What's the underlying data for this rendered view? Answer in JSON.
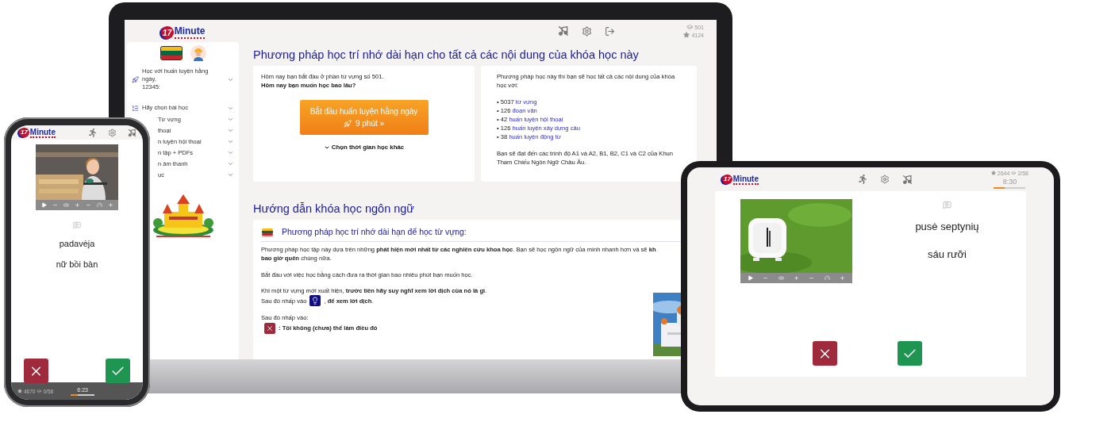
{
  "laptop": {
    "header": {
      "logo": {
        "number": "17",
        "word": "Minute"
      },
      "stats": [
        "501",
        "4124"
      ]
    },
    "sidebar": {
      "daily": {
        "lines": [
          "Học với huấn luyện hằng",
          "ngày,",
          "12345:"
        ]
      },
      "items": [
        {
          "kind": "picker",
          "label": "Hãy chọn bài học"
        },
        {
          "kind": "section",
          "label": "Từ vựng"
        },
        {
          "kind": "section",
          "label": "thoại"
        },
        {
          "kind": "section",
          "label": "n luyện hội thoại"
        },
        {
          "kind": "section",
          "label": "n tập + PDFs"
        },
        {
          "kind": "section",
          "label": "n âm thanh"
        },
        {
          "kind": "section",
          "label": "ục"
        }
      ]
    },
    "courses_title": "Phương pháp học trí nhớ dài hạn cho tất cả các nội dung của khóa học này",
    "start_card": {
      "intro": "Hôm nay bạn bắt đầu ở phần từ vựng số 501.",
      "question": "Hôm nay bạn muốn học bao lâu?",
      "button": {
        "line1": "Bắt đầu huấn luyện hằng ngày",
        "line2": "9 phút »"
      },
      "other_time": "Chọn thời gian học khác"
    },
    "contents_card": {
      "bullet": "•",
      "intro_lines": [
        "Phương pháp học này thì bạn sẽ học tất cả các nội dung của khóa",
        "học với:"
      ],
      "items": [
        {
          "count": "5037",
          "link": "từ vựng"
        },
        {
          "count": "126",
          "link": "đoạn văn"
        },
        {
          "count": "42",
          "link": "huấn luyện hội thoại"
        },
        {
          "count": "126",
          "link": "huấn luyện xây dựng câu"
        },
        {
          "count": "38",
          "link": "huấn luyện động từ"
        }
      ],
      "levels_lines": [
        "Bạn sẽ đạt đến các trình độ A1 và A2, B1, B2, C1 và C2 của Khun",
        "Tham Chiếu Ngôn Ngữ Châu Âu."
      ]
    },
    "guide_title": "Hướng dẫn khóa học ngôn ngữ",
    "guide": {
      "heading": "Phương pháp học trí nhớ dài hạn để học từ vựng:",
      "blocks": [
        [
          {
            "kind": "text",
            "text": "Phương pháp học tập này dựa trên những **phát hiện mới nhất từ các nghiên cứu khoa học**. Bạn sẽ học ngôn ngữ của mình nhanh hơn và sẽ **kh**"
          },
          {
            "kind": "text",
            "text": "**bao giờ quên** chúng nữa."
          }
        ],
        [
          {
            "kind": "text",
            "text": "Bắt đầu với việc học bằng cách đưa ra thời gian bao nhiêu phút bạn muốn học."
          }
        ],
        [
          {
            "kind": "text",
            "text": "Khi một từ vựng mới xuất hiện, **trước tiên hãy suy nghĩ xem lời dịch của nó là gì**."
          },
          {
            "kind": "hint",
            "before": "Sau đó nhấp vào",
            "after": ", **để xem lời dịch**."
          }
        ],
        [
          {
            "kind": "text",
            "text": "Sau đó nhấp vào:"
          },
          {
            "kind": "answer",
            "text": ": Tôi không (chưa) thể làm điều đó"
          }
        ]
      ]
    }
  },
  "phone": {
    "logo": {
      "number": "17",
      "word": "Minute"
    },
    "word": "padavėja",
    "translation": "nữ bồi bàn",
    "stats": [
      "4670",
      "0/58"
    ],
    "timer": "6:23",
    "progress": {
      "level": 0.3
    }
  },
  "tablet": {
    "logo": {
      "number": "17",
      "word": "Minute"
    },
    "word": "pusė septynių",
    "translation": "sáu rưỡi",
    "stats": [
      "2644",
      "2/58"
    ],
    "timer": "8:30",
    "progress": {
      "level": 0.35
    }
  }
}
